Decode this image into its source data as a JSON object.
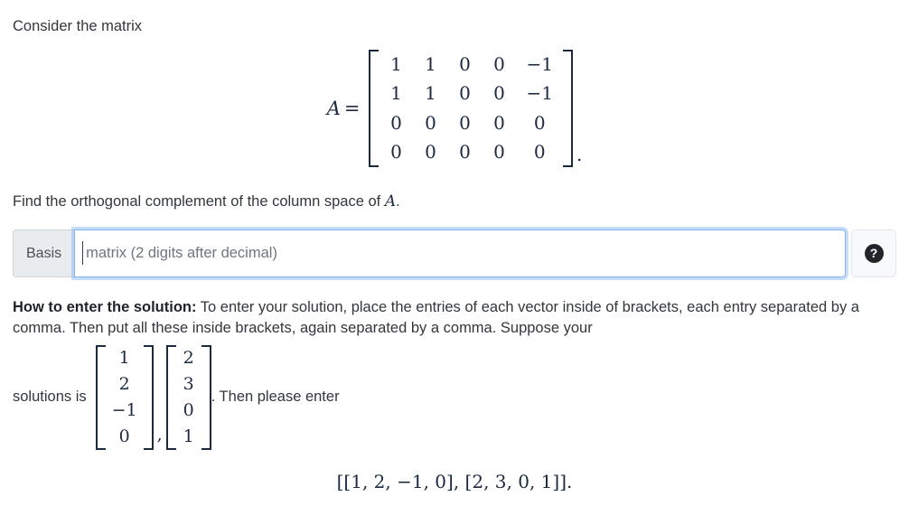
{
  "intro": {
    "text": "Consider the matrix"
  },
  "matrix_display": {
    "label": "A",
    "equals": "=",
    "rows": [
      [
        "1",
        "1",
        "0",
        "0",
        "−1"
      ],
      [
        "1",
        "1",
        "0",
        "0",
        "−1"
      ],
      [
        "0",
        "0",
        "0",
        "0",
        "0"
      ],
      [
        "0",
        "0",
        "0",
        "0",
        "0"
      ]
    ],
    "trailing_punctuation": "."
  },
  "question": {
    "prefix": "Find the orthogonal complement of the column space of ",
    "variable": "A",
    "suffix": "."
  },
  "answer_row": {
    "prefix_label": "Basis",
    "input_placeholder": "matrix (2 digits after decimal)",
    "input_value": "",
    "help_icon": "question-mark-circle-icon",
    "help_glyph": "?"
  },
  "howto": {
    "heading": "How to enter the solution:",
    "body": " To enter your solution, place the entries of each vector inside of brackets, each entry separated by a comma. Then put all these inside brackets, again separated by a comma. Suppose your"
  },
  "vector_example": {
    "lead_text": "solutions is",
    "vectors": [
      [
        "1",
        "2",
        "−1",
        "0"
      ],
      [
        "2",
        "3",
        "0",
        "1"
      ]
    ],
    "separator": ",",
    "tail_text": ". Then please enter"
  },
  "final_answer": {
    "text": "[[1, 2, −1, 0], [2, 3, 0, 1]]."
  },
  "colors": {
    "page_background": "#ffffff",
    "body_text": "#32373d",
    "math_text": "#1b2a41",
    "input_prefix_background": "#e9ecef",
    "input_prefix_border": "#ced4da",
    "input_focus_border": "#80b4f3",
    "help_button_background": "#f8f9fa",
    "help_icon_fill": "#212529"
  }
}
